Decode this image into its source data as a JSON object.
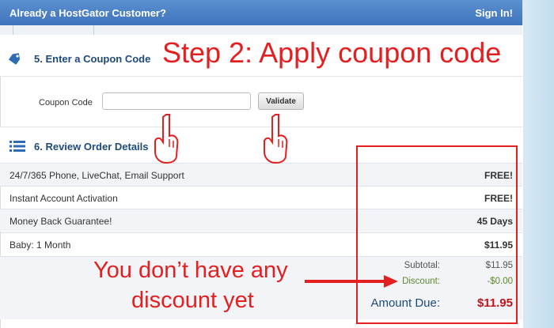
{
  "topbar": {
    "customer_text": "Already a HostGator Customer?",
    "sign_in": "Sign In!"
  },
  "coupon": {
    "title": "5. Enter a Coupon Code",
    "field_label": "Coupon Code",
    "input_value": "",
    "validate_label": "Validate",
    "icon": "tag-icon"
  },
  "review": {
    "title": "6. Review Order Details",
    "icon": "list-icon"
  },
  "items": [
    {
      "label": "24/7/365 Phone, LiveChat, Email Support",
      "value": "FREE!"
    },
    {
      "label": "Instant Account Activation",
      "value": "FREE!"
    },
    {
      "label": "Money Back Guarantee!",
      "value": "45 Days"
    },
    {
      "label": "Baby: 1 Month",
      "value": "$11.95"
    }
  ],
  "summary": {
    "subtotal_label": "Subtotal:",
    "subtotal_value": "$11.95",
    "discount_label": "Discount:",
    "discount_value": "-$0.00",
    "amount_due_label": "Amount Due:",
    "amount_due_value": "$11.95"
  },
  "annotations": {
    "step_title": "Step 2: Apply coupon code",
    "note_line1": "You don’t have any",
    "note_line2": "discount yet"
  },
  "colors": {
    "annotation_red": "#e31f1f",
    "header_blue": "#4a7fc6",
    "title_blue": "#1d4a7c",
    "discount_green": "#5a8a2a",
    "amount_red": "#c0141b"
  }
}
